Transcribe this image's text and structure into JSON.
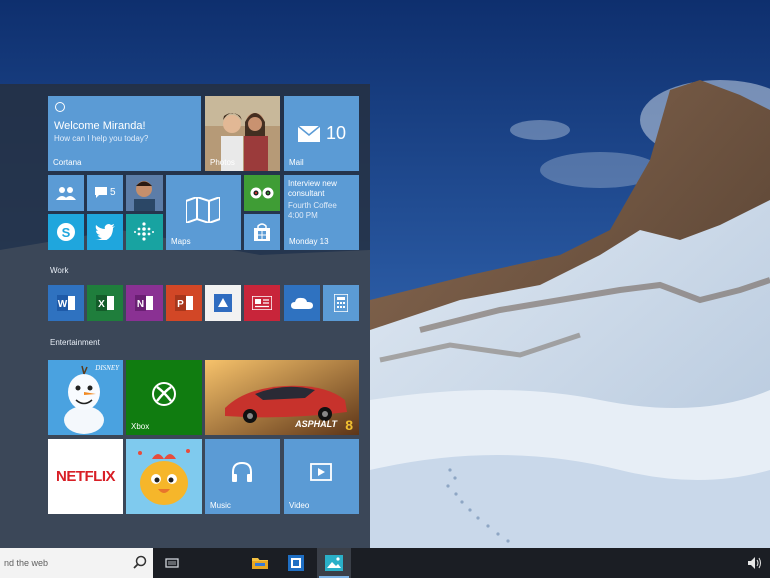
{
  "start_menu": {
    "cortana": {
      "welcome": "Welcome Miranda!",
      "prompt": "How can I help you today?",
      "label": "Cortana"
    },
    "photos": {
      "label": "Photos"
    },
    "mail": {
      "label": "Mail",
      "count": "10"
    },
    "messaging": {
      "count": "5"
    },
    "maps": {
      "label": "Maps"
    },
    "calendar": {
      "line1": "Interview new",
      "line2": "consultant",
      "line3": "Fourth Coffee",
      "time": "4:00 PM",
      "date": "Monday 13"
    },
    "groups": {
      "work": "Work",
      "entertainment": "Entertainment"
    },
    "xbox": {
      "label": "Xbox"
    },
    "music": {
      "label": "Music"
    },
    "video": {
      "label": "Video"
    },
    "netflix": {
      "label": "NETFLIX"
    },
    "disney": {
      "label": "DISNEY"
    },
    "asphalt": {
      "label": "ASPHALT",
      "number": "8"
    }
  },
  "taskbar": {
    "search_text": "nd the web",
    "icons": [
      "task-view-icon",
      "file-explorer-icon",
      "outlook-icon",
      "photos-app-icon"
    ],
    "tray_icon": "speaker-icon"
  },
  "colors": {
    "tile_blue": "#5b9bd5",
    "tile_dark_blue": "#2f72c0",
    "taskbar": "#1b1e24",
    "start_bg": "#26303e"
  }
}
